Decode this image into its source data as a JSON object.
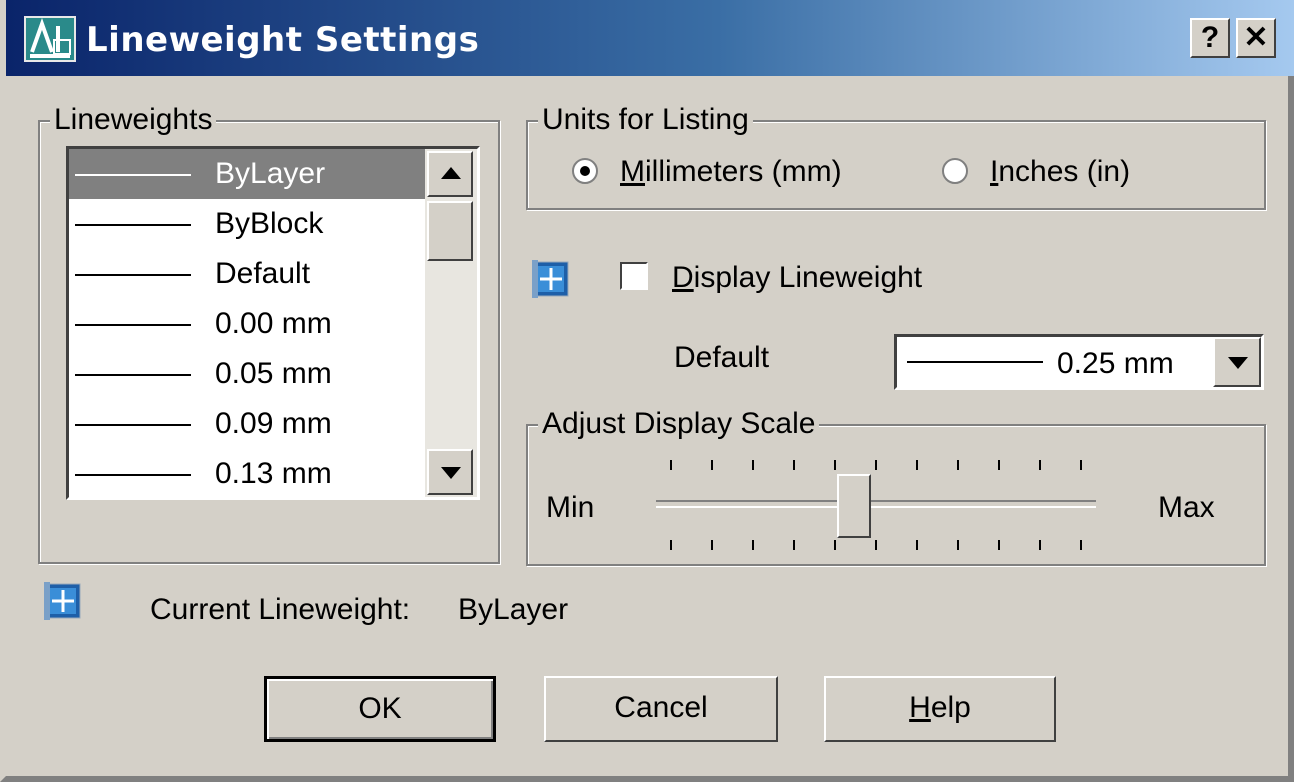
{
  "window": {
    "title": "Lineweight Settings",
    "help_label": "?",
    "close_label": "✕"
  },
  "lineweights": {
    "legend": "Lineweights",
    "items": [
      {
        "label": "ByLayer",
        "selected": true
      },
      {
        "label": "ByBlock"
      },
      {
        "label": "Default"
      },
      {
        "label": "0.00 mm"
      },
      {
        "label": "0.05 mm"
      },
      {
        "label": "0.09 mm"
      },
      {
        "label": "0.13 mm"
      }
    ]
  },
  "units": {
    "legend": "Units for Listing",
    "millimeters": {
      "mnemonic": "M",
      "rest": "illimeters (mm)",
      "selected": true
    },
    "inches": {
      "mnemonic": "I",
      "rest": "nches (in)",
      "selected": false
    }
  },
  "display": {
    "mnemonic": "D",
    "rest": "isplay Lineweight",
    "checked": false
  },
  "default_setting": {
    "label": "Default",
    "value": "0.25 mm"
  },
  "scale": {
    "legend": "Adjust Display Scale",
    "min_label": "Min",
    "max_label": "Max",
    "level": 0.45
  },
  "current": {
    "label": "Current Lineweight:",
    "value": "ByLayer"
  },
  "buttons": {
    "ok": "OK",
    "cancel": "Cancel",
    "help_mnemonic": "H",
    "help_rest": "elp"
  },
  "colors": {
    "title_start": "#0a246a",
    "title_end": "#a6caf0",
    "face": "#d4d0c8",
    "selection": "#808080"
  }
}
